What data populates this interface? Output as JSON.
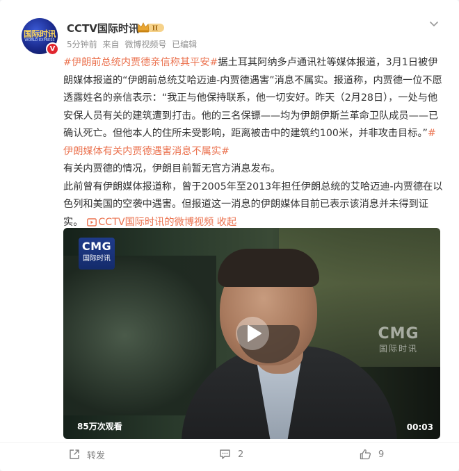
{
  "post": {
    "author": "CCTV国际时讯",
    "avatar_text": "国际时讯",
    "avatar_sub": "WORLD EXPRESS",
    "verified_mark": "V",
    "vip_level": "II",
    "time": "5分钟前",
    "source_prefix": "来自",
    "source": "微博视频号",
    "edited": "已编辑"
  },
  "content": {
    "tag1": "#伊朗前总统内贾德亲信称其平安#",
    "p1_text": "据土耳其阿纳多卢通讯社等媒体报道，3月1日被伊朗媒体报道的“伊朗前总统艾哈迈迪-内贾德遇害”消息不属实。报道称，内贾德一位不愿透露姓名的亲信表示：“我正与他保持联系，他一切安好。昨天（2月28日），一处与他安保人员有关的建筑遭到打击。他的三名保镖——均为伊朗伊斯兰革命卫队成员——已确认死亡。但他本人的住所未受影响，距离被击中的建筑约100米，并非攻击目标。”",
    "tag2": "#伊朗媒体有关内贾德遇害消息不属实#",
    "p2": "有关内贾德的情况，伊朗目前暂无官方消息发布。",
    "p3_text": "此前曾有伊朗媒体报道称，曾于2005年至2013年担任伊朗总统的艾哈迈迪-内贾德在以色列和美国的空袭中遇害。但报道这一消息的伊朗媒体目前已表示该消息并未得到证实。",
    "video_link": "CCTV国际时讯的微博视频",
    "collapse": "收起"
  },
  "video": {
    "badge_line1": "CMG",
    "badge_line2": "国际时讯",
    "watermark_line1": "CMG",
    "watermark_line2": "国际时讯",
    "views": "85万次观看",
    "duration": "00:03"
  },
  "footer": {
    "repost": "转发",
    "comments": "2",
    "likes": "9"
  },
  "colors": {
    "accent": "#eb7350",
    "verified": "#e0262f",
    "meta": "#939393"
  },
  "icons": {
    "menu": "chevron-down-icon",
    "repost": "share-icon",
    "comment": "comment-icon",
    "like": "thumbs-up-icon",
    "video_link": "video-icon",
    "play": "play-icon"
  }
}
